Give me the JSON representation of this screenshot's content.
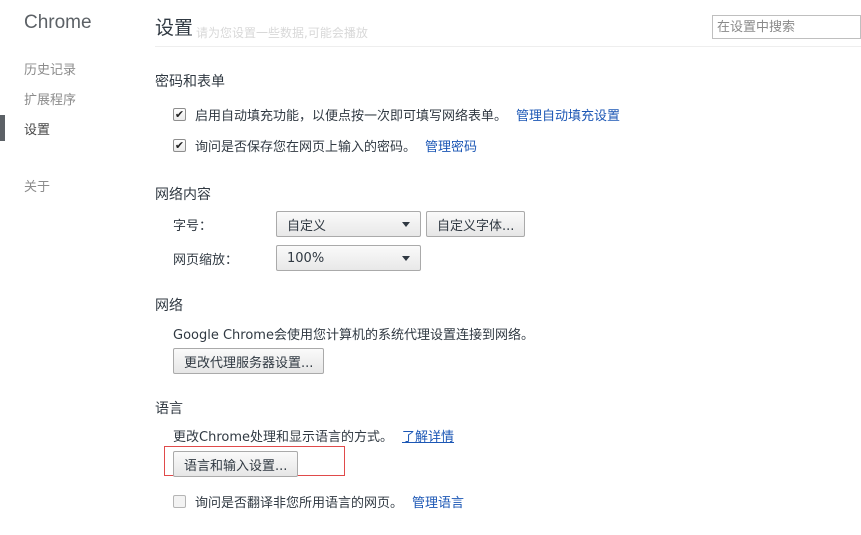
{
  "sidebar": {
    "brand": "Chrome",
    "items": [
      {
        "label": "历史记录"
      },
      {
        "label": "扩展程序"
      },
      {
        "label": "设置"
      },
      {
        "label": "关于"
      }
    ]
  },
  "header": {
    "title": "设置",
    "ghost_text": "请为您设置一些数据,可能会播放",
    "search_placeholder": "在设置中搜索"
  },
  "passwords": {
    "title": "密码和表单",
    "autofill_label": "启用自动填充功能，以便点按一次即可填写网络表单。",
    "autofill_link": "管理自动填充设置",
    "autofill_checked": true,
    "save_password_label": "询问是否保存您在网页上输入的密码。",
    "save_password_link": "管理密码",
    "save_password_checked": true
  },
  "web_content": {
    "title": "网络内容",
    "font_size_label": "字号：",
    "font_size_value": "自定义",
    "customize_fonts_button": "自定义字体...",
    "zoom_label": "网页缩放：",
    "zoom_value": "100%"
  },
  "network": {
    "title": "网络",
    "description": "Google Chrome会使用您计算机的系统代理设置连接到网络。",
    "proxy_button": "更改代理服务器设置..."
  },
  "languages": {
    "title": "语言",
    "description": "更改Chrome处理和显示语言的方式。",
    "learn_more_link": "了解详情",
    "settings_button": "语言和输入设置...",
    "translate_label": "询问是否翻译非您所用语言的网页。",
    "translate_link": "管理语言",
    "translate_checked": false
  },
  "colors": {
    "link": "#1c57b5",
    "highlight": "#e04a4a"
  }
}
